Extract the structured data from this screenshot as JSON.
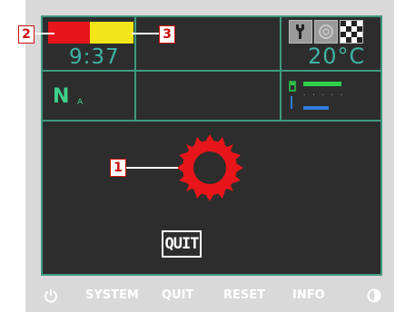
{
  "status": {
    "time": "9:37",
    "temperature": "20°C",
    "mode_label": "N",
    "mode_sub": "A"
  },
  "callouts": {
    "c1": "1",
    "c2": "2",
    "c3": "3"
  },
  "screen": {
    "quit_button": "QUIT"
  },
  "softkeys": {
    "system": "SYSTEM",
    "quit": "QUIT",
    "reset": "RESET",
    "info": "INFO"
  },
  "icons": {
    "power": "power-icon",
    "wrench": "wrench-icon",
    "gear": "gear-icon",
    "checkered_flag": "checkered-flag-icon",
    "contrast": "contrast-icon",
    "fuel": "fuel-icon",
    "sprocket": "sprocket-icon"
  },
  "colors": {
    "screen_bg": "#2d2d2d",
    "grid_lines": "#3f9a80",
    "digits": "#3fb3a3",
    "indicator_red": "#e8151a",
    "indicator_yellow": "#f2e51a",
    "sprocket": "#e8151a"
  }
}
